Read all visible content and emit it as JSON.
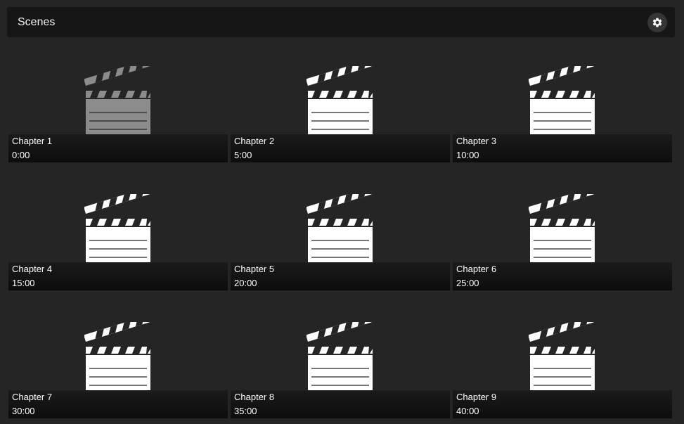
{
  "header": {
    "title": "Scenes",
    "settings_icon": "gear-icon"
  },
  "colors": {
    "background": "#252525",
    "header_bg": "#161616",
    "clapper_default": "#ffffff",
    "clapper_selected": "#8c8c8c"
  },
  "scenes": [
    {
      "title": "Chapter 1",
      "time": "0:00",
      "icon": "clapperboard-icon",
      "selected": true
    },
    {
      "title": "Chapter 2",
      "time": "5:00",
      "icon": "clapperboard-icon",
      "selected": false
    },
    {
      "title": "Chapter 3",
      "time": "10:00",
      "icon": "clapperboard-icon",
      "selected": false
    },
    {
      "title": "Chapter 4",
      "time": "15:00",
      "icon": "clapperboard-icon",
      "selected": false
    },
    {
      "title": "Chapter 5",
      "time": "20:00",
      "icon": "clapperboard-icon",
      "selected": false
    },
    {
      "title": "Chapter 6",
      "time": "25:00",
      "icon": "clapperboard-icon",
      "selected": false
    },
    {
      "title": "Chapter 7",
      "time": "30:00",
      "icon": "clapperboard-icon",
      "selected": false
    },
    {
      "title": "Chapter 8",
      "time": "35:00",
      "icon": "clapperboard-icon",
      "selected": false
    },
    {
      "title": "Chapter 9",
      "time": "40:00",
      "icon": "clapperboard-icon",
      "selected": false
    }
  ]
}
